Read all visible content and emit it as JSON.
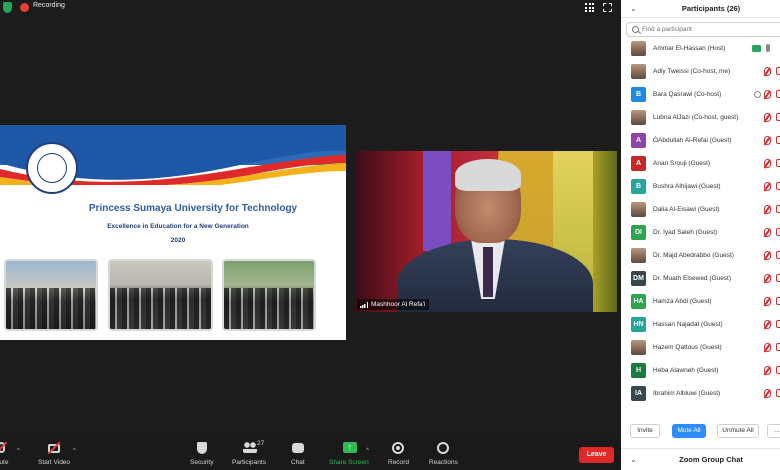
{
  "topbar": {
    "recording_label": "Recording"
  },
  "slide": {
    "title": "Princess Sumaya University for Technology",
    "subtitle": "Excellence in Education for a New Generation",
    "year": "2020"
  },
  "video": {
    "speaker_name": "Mashhoor Al Refa'i"
  },
  "toolbar": {
    "mute_label": "mute",
    "start_video_label": "Start Video",
    "security_label": "Security",
    "participants_label": "Participants",
    "participants_count": "27",
    "chat_label": "Chat",
    "share_label": "Share Screen",
    "record_label": "Record",
    "reactions_label": "Reactions",
    "leave_label": "Leave"
  },
  "panel": {
    "title": "Participants (26)",
    "search_placeholder": "Find a participant",
    "participants": [
      {
        "name": "Ammar El-Hassan (Host)",
        "initials": "",
        "avatar_color": "#9aa7b8",
        "status": "host"
      },
      {
        "name": "Adiy Tweissi (Co-host, me)",
        "initials": "",
        "avatar_color": "#8a7a6a",
        "status": "muted"
      },
      {
        "name": "Bara Qasrawi (Co-host)",
        "initials": "B",
        "avatar_color": "#1e88e5",
        "status": "muted-circle"
      },
      {
        "name": "Lubna AlJazi (Co-host, guest)",
        "initials": "",
        "avatar_color": "#a07060",
        "status": "muted"
      },
      {
        "name": "ÓAbdullah Al-Refai (Guest)",
        "initials": "A",
        "avatar_color": "#8e44ad",
        "status": "muted"
      },
      {
        "name": "Anan Srouji (Guest)",
        "initials": "A",
        "avatar_color": "#c62828",
        "status": "muted"
      },
      {
        "name": "Bushra Alhijawi (Guest)",
        "initials": "B",
        "avatar_color": "#26a69a",
        "status": "muted"
      },
      {
        "name": "Dalia Al-Eisawi (Guest)",
        "initials": "",
        "avatar_color": "#b07a60",
        "status": "muted"
      },
      {
        "name": "Dr. Iyad Saleh (Guest)",
        "initials": "DI",
        "avatar_color": "#2ea44f",
        "status": "muted"
      },
      {
        "name": "Dr. Majd Abedrabbo (Guest)",
        "initials": "",
        "avatar_color": "#6a6a6a",
        "status": "muted"
      },
      {
        "name": "Dr. Muath Elsewed (Guest)",
        "initials": "DM",
        "avatar_color": "#37474f",
        "status": "muted"
      },
      {
        "name": "Hamza Abdi (Guest)",
        "initials": "HA",
        "avatar_color": "#2ea44f",
        "status": "muted"
      },
      {
        "name": "Hassan Najadat (Guest)",
        "initials": "HN",
        "avatar_color": "#26a69a",
        "status": "muted"
      },
      {
        "name": "Hazem Qattous (Guest)",
        "initials": "",
        "avatar_color": "#c4705a",
        "status": "muted"
      },
      {
        "name": "Heba Alawneh (Guest)",
        "initials": "H",
        "avatar_color": "#1b7a3e",
        "status": "muted"
      },
      {
        "name": "Ibrahim Albluwi (Guest)",
        "initials": "IA",
        "avatar_color": "#37474f",
        "status": "muted"
      }
    ],
    "invite_label": "Invite",
    "mute_all_label": "Mute All",
    "unmute_all_label": "Unmute All",
    "more_label": "...",
    "chat_title": "Zoom Group Chat"
  },
  "colors": {
    "accent_blue": "#2d8cff",
    "leave_red": "#e02828",
    "share_green": "#2fba52",
    "muted_red": "#d32f2f"
  }
}
